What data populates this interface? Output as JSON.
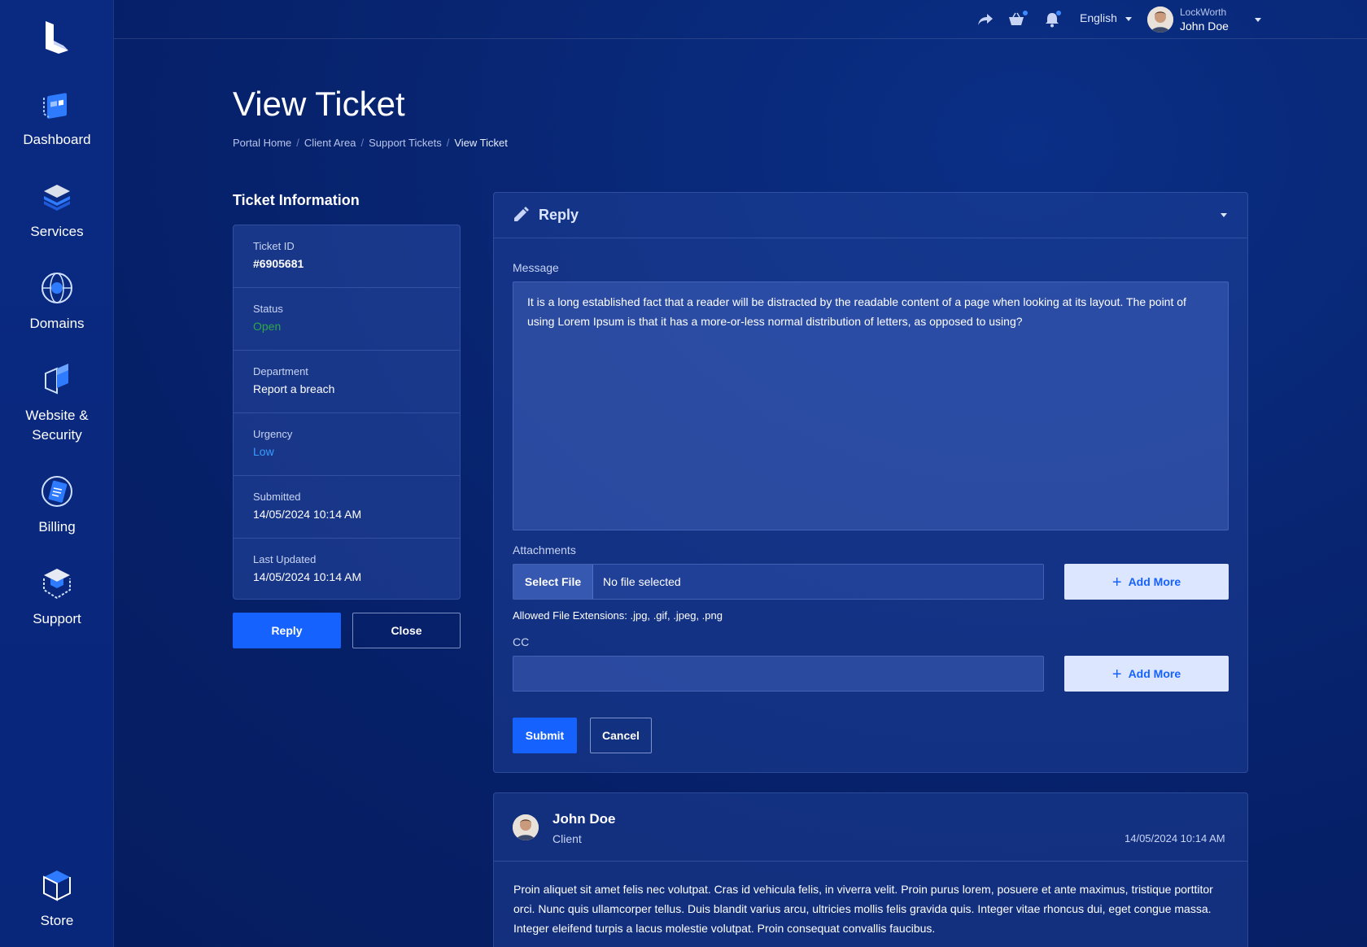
{
  "sidebar": {
    "items": [
      {
        "label": "Dashboard"
      },
      {
        "label": "Services"
      },
      {
        "label": "Domains"
      },
      {
        "label": "Website &",
        "label2": "Security"
      },
      {
        "label": "Billing"
      },
      {
        "label": "Support"
      },
      {
        "label": "Store"
      }
    ]
  },
  "topbar": {
    "language": "English",
    "company": "LockWorth",
    "user_name": "John Doe"
  },
  "page": {
    "title": "View Ticket",
    "breadcrumb": [
      "Portal Home",
      "Client Area",
      "Support Tickets",
      "View Ticket"
    ]
  },
  "ticket_info": {
    "heading": "Ticket Information",
    "rows": [
      {
        "label": "Ticket ID",
        "value": "#6905681"
      },
      {
        "label": "Status",
        "value": "Open"
      },
      {
        "label": "Department",
        "value": "Report a breach"
      },
      {
        "label": "Urgency",
        "value": "Low"
      },
      {
        "label": "Submitted",
        "value": "14/05/2024 10:14 AM"
      },
      {
        "label": "Last Updated",
        "value": "14/05/2024 10:14 AM"
      }
    ],
    "reply_label": "Reply",
    "close_label": "Close"
  },
  "reply": {
    "title": "Reply",
    "message_label": "Message",
    "message_value": "It is a long established fact that a reader will be distracted by the readable content of a page when looking at its layout. The point of using Lorem Ipsum is that it has a more-or-less normal distribution of letters, as opposed to using?",
    "attachments_label": "Attachments",
    "select_file_label": "Select File",
    "file_status": "No file selected",
    "add_more_label": "Add More",
    "allowed_extensions": "Allowed File Extensions: .jpg, .gif, .jpeg, .png",
    "cc_label": "CC",
    "cc_value": "",
    "submit_label": "Submit",
    "cancel_label": "Cancel"
  },
  "message": {
    "author": "John Doe",
    "role": "Client",
    "date": "14/05/2024 10:14 AM",
    "body": "Proin aliquet sit amet felis nec volutpat. Cras id vehicula felis, in viverra velit. Proin purus lorem, posuere et ante maximus, tristique porttitor orci. Nunc quis ullamcorper tellus. Duis blandit varius arcu, ultricies mollis felis gravida quis. Integer vitae rhoncus dui, eget congue massa. Integer eleifend turpis a lacus molestie volutpat. Proin consequat convallis faucibus."
  },
  "colors": {
    "accent": "#1662ff",
    "status_open": "#2ea84a",
    "urgency_low": "#3a9cff",
    "background": "#061f66"
  }
}
